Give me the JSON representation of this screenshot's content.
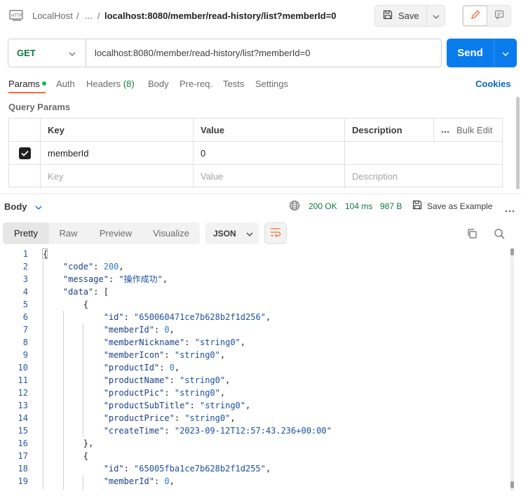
{
  "header": {
    "breadcrumb_root": "LocalHost",
    "breadcrumb_sep1": "/",
    "breadcrumb_ellipsis": "...",
    "breadcrumb_sep2": "/",
    "title": "localhost:8080/member/read-history/list?memberId=0",
    "save_label": "Save"
  },
  "request": {
    "method": "GET",
    "url": "localhost:8080/member/read-history/list?memberId=0",
    "send_label": "Send"
  },
  "tabs": {
    "params": "Params",
    "auth": "Auth",
    "headers": "Headers",
    "headers_count": "(8)",
    "body": "Body",
    "prereq": "Pre-req.",
    "tests": "Tests",
    "settings": "Settings",
    "cookies": "Cookies"
  },
  "query_params": {
    "title": "Query Params",
    "col_key": "Key",
    "col_value": "Value",
    "col_description": "Description",
    "bulk_edit": "Bulk Edit",
    "rows": [
      {
        "key": "memberId",
        "value": "0",
        "description": ""
      }
    ],
    "placeholder_key": "Key",
    "placeholder_value": "Value",
    "placeholder_description": "Description"
  },
  "response": {
    "body_label": "Body",
    "status": "200 OK",
    "time": "104 ms",
    "size": "987 B",
    "save_example": "Save as Example",
    "view_tabs": [
      "Pretty",
      "Raw",
      "Preview",
      "Visualize"
    ],
    "format": "JSON"
  },
  "code_lines": [
    [
      [
        "p",
        "{"
      ]
    ],
    [
      [
        "p",
        "    "
      ],
      [
        "k",
        "\"code\""
      ],
      [
        "p",
        ": "
      ],
      [
        "n",
        "200"
      ],
      [
        "p",
        ","
      ]
    ],
    [
      [
        "p",
        "    "
      ],
      [
        "k",
        "\"message\""
      ],
      [
        "p",
        ": "
      ],
      [
        "s",
        "\"操作成功\""
      ],
      [
        "p",
        ","
      ]
    ],
    [
      [
        "p",
        "    "
      ],
      [
        "k",
        "\"data\""
      ],
      [
        "p",
        ": ["
      ]
    ],
    [
      [
        "p",
        "        {"
      ]
    ],
    [
      [
        "p",
        "            "
      ],
      [
        "k",
        "\"id\""
      ],
      [
        "p",
        ": "
      ],
      [
        "s",
        "\"650060471ce7b628b2f1d256\""
      ],
      [
        "p",
        ","
      ]
    ],
    [
      [
        "p",
        "            "
      ],
      [
        "k",
        "\"memberId\""
      ],
      [
        "p",
        ": "
      ],
      [
        "n",
        "0"
      ],
      [
        "p",
        ","
      ]
    ],
    [
      [
        "p",
        "            "
      ],
      [
        "k",
        "\"memberNickname\""
      ],
      [
        "p",
        ": "
      ],
      [
        "s",
        "\"string0\""
      ],
      [
        "p",
        ","
      ]
    ],
    [
      [
        "p",
        "            "
      ],
      [
        "k",
        "\"memberIcon\""
      ],
      [
        "p",
        ": "
      ],
      [
        "s",
        "\"string0\""
      ],
      [
        "p",
        ","
      ]
    ],
    [
      [
        "p",
        "            "
      ],
      [
        "k",
        "\"productId\""
      ],
      [
        "p",
        ": "
      ],
      [
        "n",
        "0"
      ],
      [
        "p",
        ","
      ]
    ],
    [
      [
        "p",
        "            "
      ],
      [
        "k",
        "\"productName\""
      ],
      [
        "p",
        ": "
      ],
      [
        "s",
        "\"string0\""
      ],
      [
        "p",
        ","
      ]
    ],
    [
      [
        "p",
        "            "
      ],
      [
        "k",
        "\"productPic\""
      ],
      [
        "p",
        ": "
      ],
      [
        "s",
        "\"string0\""
      ],
      [
        "p",
        ","
      ]
    ],
    [
      [
        "p",
        "            "
      ],
      [
        "k",
        "\"productSubTitle\""
      ],
      [
        "p",
        ": "
      ],
      [
        "s",
        "\"string0\""
      ],
      [
        "p",
        ","
      ]
    ],
    [
      [
        "p",
        "            "
      ],
      [
        "k",
        "\"productPrice\""
      ],
      [
        "p",
        ": "
      ],
      [
        "s",
        "\"string0\""
      ],
      [
        "p",
        ","
      ]
    ],
    [
      [
        "p",
        "            "
      ],
      [
        "k",
        "\"createTime\""
      ],
      [
        "p",
        ": "
      ],
      [
        "s",
        "\"2023-09-12T12:57:43.236+00:00\""
      ]
    ],
    [
      [
        "p",
        "        },"
      ]
    ],
    [
      [
        "p",
        "        {"
      ]
    ],
    [
      [
        "p",
        "            "
      ],
      [
        "k",
        "\"id\""
      ],
      [
        "p",
        ": "
      ],
      [
        "s",
        "\"65005fba1ce7b628b2f1d255\""
      ],
      [
        "p",
        ","
      ]
    ],
    [
      [
        "p",
        "            "
      ],
      [
        "k",
        "\"memberId\""
      ],
      [
        "p",
        ": "
      ],
      [
        "n",
        "0"
      ],
      [
        "p",
        ","
      ]
    ]
  ],
  "colors": {
    "accent": "#f26b3a",
    "send": "#097bed",
    "method": "#0c7a43",
    "status_ok": "#0c7a43",
    "link": "#0b66c9"
  }
}
